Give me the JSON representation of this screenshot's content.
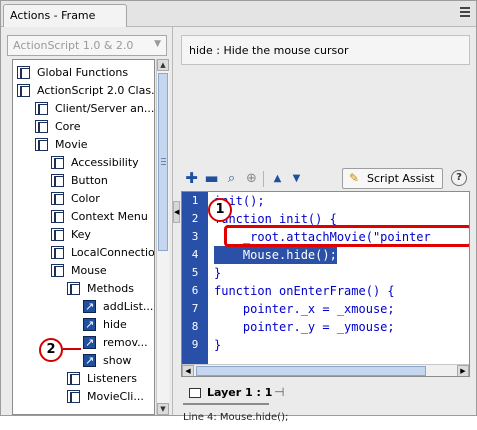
{
  "window": {
    "title": "Actions - Frame"
  },
  "left_panel": {
    "language_select": "ActionScript 1.0 & 2.0",
    "tree": [
      {
        "label": "Global Functions",
        "icon": "book-icon"
      },
      {
        "label": "ActionScript 2.0 Clas...",
        "icon": "book-icon"
      },
      {
        "label": "Client/Server an...",
        "icon": "book-icon"
      },
      {
        "label": "Core",
        "icon": "book-icon"
      },
      {
        "label": "Movie",
        "icon": "book-icon"
      },
      {
        "label": "Accessibility",
        "icon": "book-icon"
      },
      {
        "label": "Button",
        "icon": "book-icon"
      },
      {
        "label": "Color",
        "icon": "book-icon"
      },
      {
        "label": "Context Menu",
        "icon": "book-icon"
      },
      {
        "label": "Key",
        "icon": "book-icon"
      },
      {
        "label": "LocalConnection",
        "icon": "book-icon"
      },
      {
        "label": "Mouse",
        "icon": "book-icon"
      },
      {
        "label": "Methods",
        "icon": "book-icon"
      },
      {
        "label": "addList...",
        "icon": "function-icon"
      },
      {
        "label": "hide",
        "icon": "function-icon"
      },
      {
        "label": "remov...",
        "icon": "function-icon"
      },
      {
        "label": "show",
        "icon": "function-icon"
      },
      {
        "label": "Listeners",
        "icon": "book-icon"
      },
      {
        "label": "MovieCli...",
        "icon": "book-icon"
      }
    ],
    "annotation_marker": "2"
  },
  "right_panel": {
    "info_text": "hide : Hide the mouse cursor",
    "toolbar": {
      "script_assist_label": "Script Assist",
      "help_label": "?"
    },
    "code_lines": [
      {
        "num": "1",
        "text": "init();"
      },
      {
        "num": "2",
        "text": "function init() {"
      },
      {
        "num": "3",
        "text": "    _root.attachMovie(\"pointer"
      },
      {
        "num": "4",
        "text": "    Mouse.hide();"
      },
      {
        "num": "5",
        "text": "}"
      },
      {
        "num": "6",
        "text": "function onEnterFrame() {"
      },
      {
        "num": "7",
        "text": "    pointer._x = _xmouse;"
      },
      {
        "num": "8",
        "text": "    pointer._y = _ymouse;"
      },
      {
        "num": "9",
        "text": "}"
      }
    ],
    "annotation_marker": "1",
    "layer_tab": "Layer 1 : 1",
    "status": "Line 4: Mouse.hide();"
  },
  "colors": {
    "highlight": "#2a50a8",
    "code_text": "#0000cc",
    "annotation": "#e00000"
  }
}
